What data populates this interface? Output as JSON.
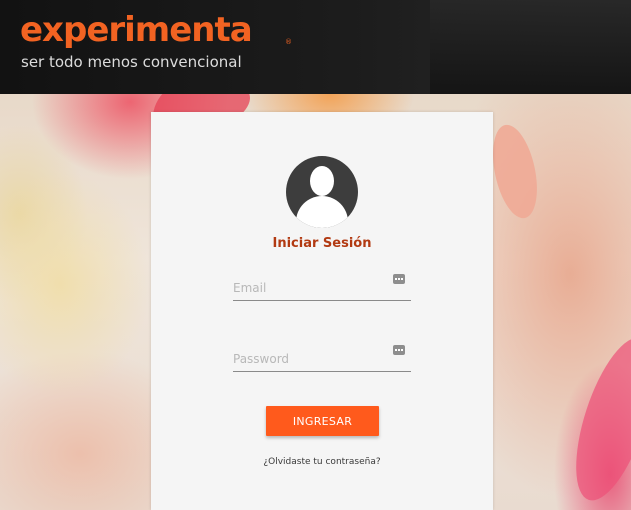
{
  "header": {
    "logo_text": "experimenta",
    "logo_registered": "®",
    "tagline": "ser todo menos convencional"
  },
  "login": {
    "title": "Iniciar Sesión",
    "email_placeholder": "Email",
    "email_value": "",
    "password_placeholder": "Password",
    "password_value": "",
    "submit_label": "INGRESAR",
    "forgot_link": "¿Olvidaste tu contraseña?",
    "field_icon": "password-manager-icon"
  },
  "colors": {
    "brand_orange": "#f26322",
    "button_orange": "#ff5a1c",
    "title_color": "#b23a12",
    "header_bg": "#1a1a1a"
  }
}
